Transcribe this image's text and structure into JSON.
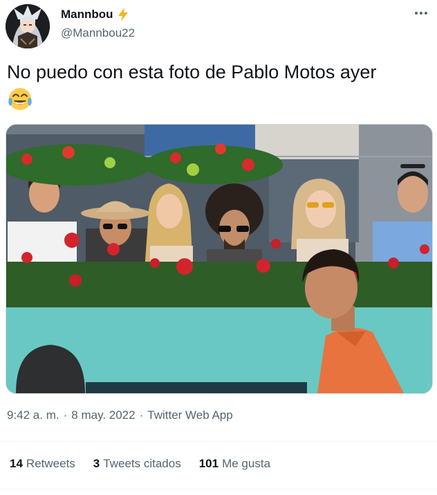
{
  "author": {
    "display_name": "Mannbou",
    "handle": "@Mannbou22",
    "badge_icon": "lightning-bolt-icon",
    "badge_color": "#f5b324"
  },
  "tweet": {
    "text": "No puedo con esta foto de Pablo Motos ayer",
    "emoji": "😂",
    "emoji_icon": "face-with-tears-of-joy-icon"
  },
  "meta": {
    "time": "9:42 a. m.",
    "separator": "·",
    "date": "8 may. 2022",
    "source": "Twitter Web App"
  },
  "stats": [
    {
      "count": "14",
      "label": "Retweets"
    },
    {
      "count": "3",
      "label": "Tweets citados"
    },
    {
      "count": "101",
      "label": "Me gusta"
    }
  ],
  "colors": {
    "text": "#0f1419",
    "secondary": "#536471",
    "border": "#cfd9de",
    "court_wall": "#69c8c3",
    "shirt": "#e8733f"
  }
}
